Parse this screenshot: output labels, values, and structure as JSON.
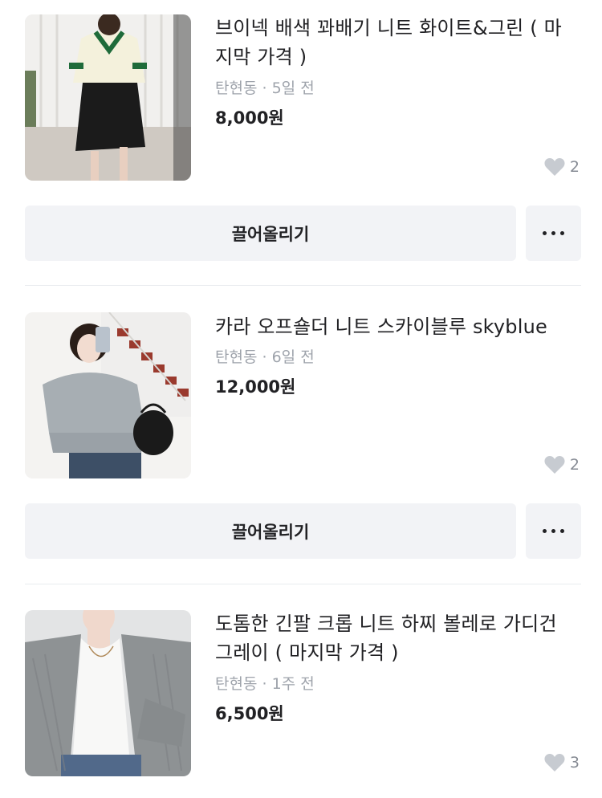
{
  "items": [
    {
      "title": "브이넥 배색 꽈배기 니트 화이트&그린 ( 마지막 가격 )",
      "location": "탄현동",
      "time": "5일 전",
      "price": "8,000원",
      "likes": "2",
      "bump_label": "끌어올리기"
    },
    {
      "title": "카라 오프숄더 니트 스카이블루 skyblue",
      "location": "탄현동",
      "time": "6일 전",
      "price": "12,000원",
      "likes": "2",
      "bump_label": "끌어올리기"
    },
    {
      "title": "도톰한 긴팔 크롭 니트 하찌 볼레로 가디건 그레이 ( 마지막 가격 )",
      "location": "탄현동",
      "time": "1주 전",
      "price": "6,500원",
      "likes": "3"
    }
  ],
  "separator": "·",
  "colors": {
    "button_bg": "#f2f3f6",
    "meta_text": "#9ea3ab",
    "heart": "#c7cbd1"
  }
}
